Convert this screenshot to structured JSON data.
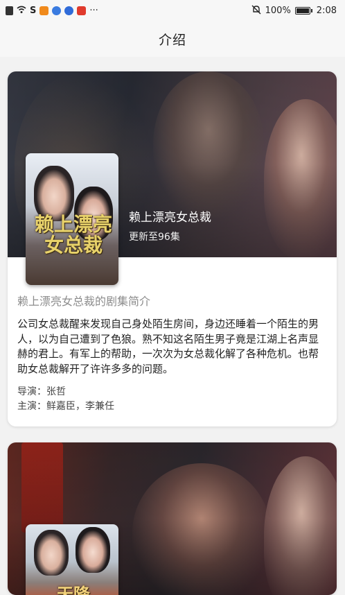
{
  "status_bar": {
    "time": "2:08",
    "battery": "100%",
    "more_dots": "···",
    "icons": [
      "sim-icon",
      "wifi-icon",
      "soul-app-icon",
      "video-app-icon",
      "browser-icon",
      "music-app-icon",
      "mail-icon"
    ],
    "mute_icon": "bell-off-icon"
  },
  "header": {
    "title": "介绍"
  },
  "drama_1": {
    "title": "赖上漂亮女总裁",
    "episodes": "更新至96集",
    "cover_text": "赖上漂亮女总裁",
    "intro_heading": "赖上漂亮女总裁的剧集简介",
    "intro_text": "公司女总裁醒来发现自己身处陌生房间，身边还睡着一个陌生的男人，以为自己遭到了色狼。熟不知这名陌生男子竟是江湖上名声显赫的君上。有军上的帮助，一次次为女总裁化解了各种危机。也帮助女总裁解开了许许多多的问题。",
    "director_label": "导演：",
    "director": "张哲",
    "cast_label": "主演：",
    "cast": "鲜嘉臣，李兼任"
  },
  "drama_2": {
    "cover_text": "天降"
  },
  "colors": {
    "page_bg": "#f2f2f2",
    "card_bg": "#ffffff",
    "heading_gray": "#8c8c8c"
  }
}
